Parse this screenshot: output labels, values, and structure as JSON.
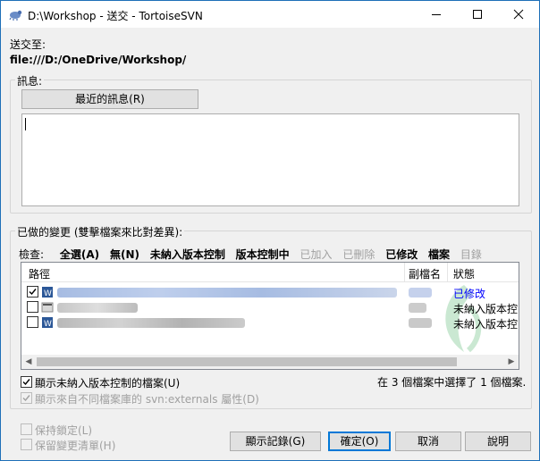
{
  "window": {
    "title": "D:\\Workshop - 送交 - TortoiseSVN"
  },
  "commit_to": {
    "label": "送交至:",
    "url": "file:///D:/OneDrive/Workshop/"
  },
  "message": {
    "group_label": "訊息:",
    "recent_button": "最近的訊息(R)",
    "text": ""
  },
  "changes": {
    "group_label": "已做的變更 (雙擊檔案來比對差異):",
    "filter": {
      "label": "檢查:",
      "items": [
        {
          "label": "全選(A)",
          "enabled": true
        },
        {
          "label": "無(N)",
          "enabled": true
        },
        {
          "label": "未納入版本控制",
          "enabled": true
        },
        {
          "label": "版本控制中",
          "enabled": true
        },
        {
          "label": "已加入",
          "enabled": false
        },
        {
          "label": "已刪除",
          "enabled": false
        },
        {
          "label": "已修改",
          "enabled": true
        },
        {
          "label": "檔案",
          "enabled": true
        },
        {
          "label": "目錄",
          "enabled": false
        }
      ]
    },
    "columns": {
      "path": "路徑",
      "ext": "副檔名",
      "status": "狀態"
    },
    "files": [
      {
        "checked": true,
        "ext": ".docx",
        "status": "已修改",
        "status_color": "#0000ff"
      },
      {
        "checked": false,
        "ext": ".bat",
        "status": "未納入版本控"
      },
      {
        "checked": false,
        "ext": ".docx",
        "status": "未納入版本控"
      }
    ]
  },
  "options": {
    "show_unversioned": {
      "label": "顯示未納入版本控制的檔案(U)",
      "checked": true
    },
    "show_externals": {
      "label": "顯示來自不同檔案庫的 svn:externals 屬性(D)",
      "checked": true,
      "enabled": false
    },
    "selection_summary": "在 3 個檔案中選擇了 1 個檔案.",
    "keep_locks": {
      "label": "保持鎖定(L)",
      "checked": false,
      "enabled": false
    },
    "keep_changelists": {
      "label": "保留變更清單(H)",
      "checked": false,
      "enabled": false
    }
  },
  "buttons": {
    "show_log": "顯示記錄(G)",
    "ok": "確定(O)",
    "cancel": "取消",
    "help": "說明"
  },
  "colors": {
    "accent": "#0078d7",
    "modified_status": "#0000ff",
    "disabled_text": "#a0a0a0"
  }
}
